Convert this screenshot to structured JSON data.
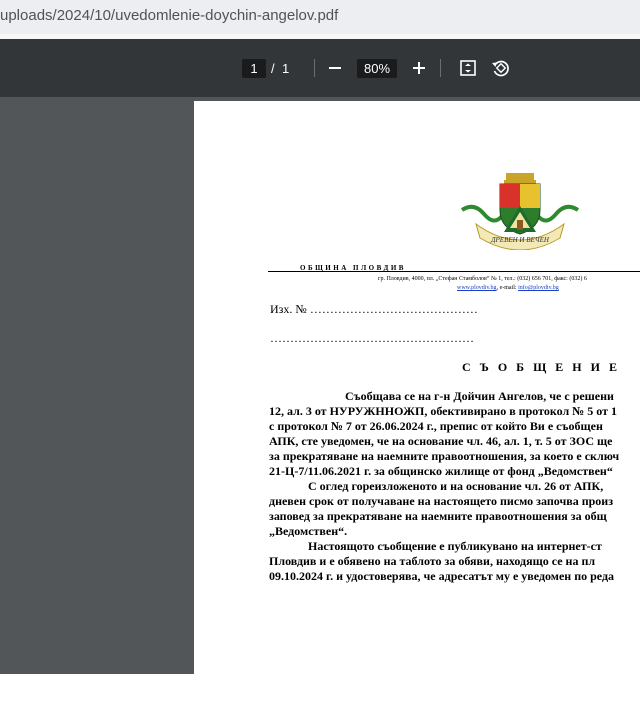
{
  "browser": {
    "url": "uploads/2024/10/uvedomlenie-doychin-angelov.pdf"
  },
  "toolbar": {
    "current_page": "1",
    "page_separator": "/",
    "total_pages": "1",
    "zoom": "80%",
    "icons": [
      "minus-icon",
      "plus-icon",
      "fit-page-icon",
      "rotate-icon"
    ]
  },
  "document": {
    "emblem_motto": "ДРЕВЕН И ВЕЧЕН",
    "org_name": "ОБЩИНА ПЛОВДИВ",
    "address": "гр. Пловдив, 4000, пл. „Стефан Стамболов“ № 1, тел.: (032) 656 701, факс: (032) 6",
    "website": "www.plovdiv.bg",
    "email_label": ", e-mail: ",
    "email": "info@plovdiv.bg",
    "ref_line": "Изх. № ……………………………………",
    "dots_line": "……………………………………………",
    "heading": "С Ъ О Б Щ Е Н И Е",
    "body_lines": [
      "Съобщава се на г-н  Дойчин  Ангелов, че с решени",
      "12, ал. 3 от НУРУЖННОЖП, обективирано в протокол № 5 от 1",
      "с протокол № 7 от 26.06.2024 г.,  препис от който Ви е съобщен",
      "АПК, сте уведомен, че на основание чл. 46, ал. 1, т. 5 от ЗОС ще",
      "за прекратяване на наемните правоотношения, за което е сключ",
      "21-Ц-7/11.06.2021 г. за общинско жилище от фонд „Ведомствен“",
      "С оглед гореизложеното и на основание чл. 26 от АПК,",
      "дневен срок от получаване на настоящето писмо започва произ",
      "заповед за прекратяване на наемните правоотношения за общ",
      "„Ведомствен“.",
      "Настоящото съобщение е публикувано на интернет-ст",
      "Пловдив и е обявено на таблото за обяви, находящо се на пл",
      "09.10.2024 г. и удостоверява, че адресатът му е уведомен по реда"
    ]
  }
}
